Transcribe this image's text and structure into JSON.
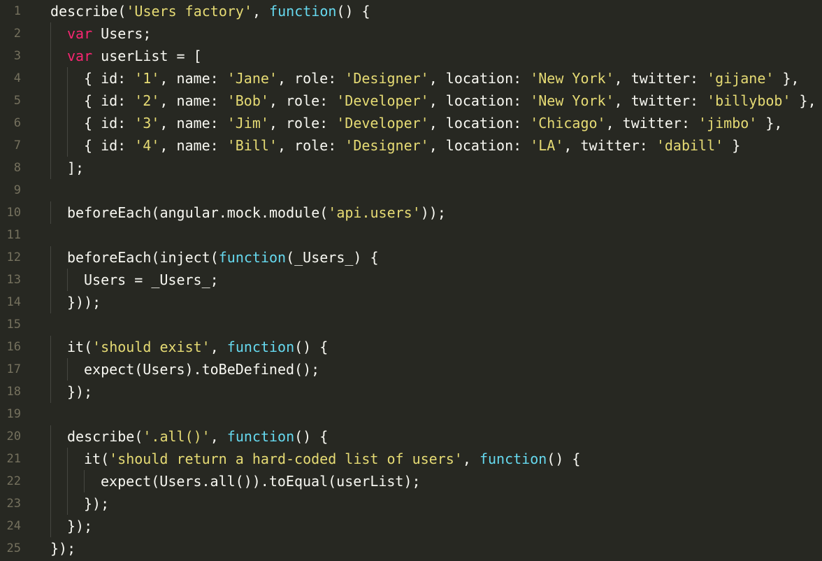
{
  "editor": {
    "theme_colors": {
      "background": "#272822",
      "text": "#f8f8f2",
      "keyword": "#f92672",
      "function_keyword": "#66d9ef",
      "string": "#e6db74",
      "line_number": "#75715e"
    },
    "lines": [
      {
        "number": "1",
        "indent": 0,
        "tokens": [
          [
            "text",
            "describe("
          ],
          [
            "string",
            "'Users factory'"
          ],
          [
            "text",
            ", "
          ],
          [
            "fn",
            "function"
          ],
          [
            "text",
            "() {"
          ]
        ]
      },
      {
        "number": "2",
        "indent": 1,
        "tokens": [
          [
            "keyword",
            "var"
          ],
          [
            "text",
            " Users;"
          ]
        ]
      },
      {
        "number": "3",
        "indent": 1,
        "tokens": [
          [
            "keyword",
            "var"
          ],
          [
            "text",
            " userList = ["
          ]
        ]
      },
      {
        "number": "4",
        "indent": 2,
        "tokens": [
          [
            "text",
            "{ id: "
          ],
          [
            "string",
            "'1'"
          ],
          [
            "text",
            ", name: "
          ],
          [
            "string",
            "'Jane'"
          ],
          [
            "text",
            ", role: "
          ],
          [
            "string",
            "'Designer'"
          ],
          [
            "text",
            ", location: "
          ],
          [
            "string",
            "'New York'"
          ],
          [
            "text",
            ", twitter: "
          ],
          [
            "string",
            "'gijane'"
          ],
          [
            "text",
            " },"
          ]
        ]
      },
      {
        "number": "5",
        "indent": 2,
        "tokens": [
          [
            "text",
            "{ id: "
          ],
          [
            "string",
            "'2'"
          ],
          [
            "text",
            ", name: "
          ],
          [
            "string",
            "'Bob'"
          ],
          [
            "text",
            ", role: "
          ],
          [
            "string",
            "'Developer'"
          ],
          [
            "text",
            ", location: "
          ],
          [
            "string",
            "'New York'"
          ],
          [
            "text",
            ", twitter: "
          ],
          [
            "string",
            "'billybob'"
          ],
          [
            "text",
            " },"
          ]
        ]
      },
      {
        "number": "6",
        "indent": 2,
        "tokens": [
          [
            "text",
            "{ id: "
          ],
          [
            "string",
            "'3'"
          ],
          [
            "text",
            ", name: "
          ],
          [
            "string",
            "'Jim'"
          ],
          [
            "text",
            ", role: "
          ],
          [
            "string",
            "'Developer'"
          ],
          [
            "text",
            ", location: "
          ],
          [
            "string",
            "'Chicago'"
          ],
          [
            "text",
            ", twitter: "
          ],
          [
            "string",
            "'jimbo'"
          ],
          [
            "text",
            " },"
          ]
        ]
      },
      {
        "number": "7",
        "indent": 2,
        "tokens": [
          [
            "text",
            "{ id: "
          ],
          [
            "string",
            "'4'"
          ],
          [
            "text",
            ", name: "
          ],
          [
            "string",
            "'Bill'"
          ],
          [
            "text",
            ", role: "
          ],
          [
            "string",
            "'Designer'"
          ],
          [
            "text",
            ", location: "
          ],
          [
            "string",
            "'LA'"
          ],
          [
            "text",
            ", twitter: "
          ],
          [
            "string",
            "'dabill'"
          ],
          [
            "text",
            " }"
          ]
        ]
      },
      {
        "number": "8",
        "indent": 1,
        "tokens": [
          [
            "text",
            "];"
          ]
        ]
      },
      {
        "number": "9",
        "indent": 0,
        "tokens": []
      },
      {
        "number": "10",
        "indent": 1,
        "tokens": [
          [
            "text",
            "beforeEach(angular.mock.module("
          ],
          [
            "string",
            "'api.users'"
          ],
          [
            "text",
            "));"
          ]
        ]
      },
      {
        "number": "11",
        "indent": 0,
        "tokens": []
      },
      {
        "number": "12",
        "indent": 1,
        "tokens": [
          [
            "text",
            "beforeEach(inject("
          ],
          [
            "fn",
            "function"
          ],
          [
            "text",
            "(_Users_) {"
          ]
        ]
      },
      {
        "number": "13",
        "indent": 2,
        "tokens": [
          [
            "text",
            "Users = _Users_;"
          ]
        ]
      },
      {
        "number": "14",
        "indent": 1,
        "tokens": [
          [
            "text",
            "}));"
          ]
        ]
      },
      {
        "number": "15",
        "indent": 0,
        "tokens": []
      },
      {
        "number": "16",
        "indent": 1,
        "tokens": [
          [
            "text",
            "it("
          ],
          [
            "string",
            "'should exist'"
          ],
          [
            "text",
            ", "
          ],
          [
            "fn",
            "function"
          ],
          [
            "text",
            "() {"
          ]
        ]
      },
      {
        "number": "17",
        "indent": 2,
        "tokens": [
          [
            "text",
            "expect(Users).toBeDefined();"
          ]
        ]
      },
      {
        "number": "18",
        "indent": 1,
        "tokens": [
          [
            "text",
            "});"
          ]
        ]
      },
      {
        "number": "19",
        "indent": 0,
        "tokens": []
      },
      {
        "number": "20",
        "indent": 1,
        "tokens": [
          [
            "text",
            "describe("
          ],
          [
            "string",
            "'.all()'"
          ],
          [
            "text",
            ", "
          ],
          [
            "fn",
            "function"
          ],
          [
            "text",
            "() {"
          ]
        ]
      },
      {
        "number": "21",
        "indent": 2,
        "tokens": [
          [
            "text",
            "it("
          ],
          [
            "string",
            "'should return a hard-coded list of users'"
          ],
          [
            "text",
            ", "
          ],
          [
            "fn",
            "function"
          ],
          [
            "text",
            "() {"
          ]
        ]
      },
      {
        "number": "22",
        "indent": 3,
        "tokens": [
          [
            "text",
            "expect(Users.all()).toEqual(userList);"
          ]
        ]
      },
      {
        "number": "23",
        "indent": 2,
        "tokens": [
          [
            "text",
            "});"
          ]
        ]
      },
      {
        "number": "24",
        "indent": 1,
        "tokens": [
          [
            "text",
            "});"
          ]
        ]
      },
      {
        "number": "25",
        "indent": 0,
        "tokens": [
          [
            "text",
            "});"
          ]
        ]
      }
    ]
  }
}
